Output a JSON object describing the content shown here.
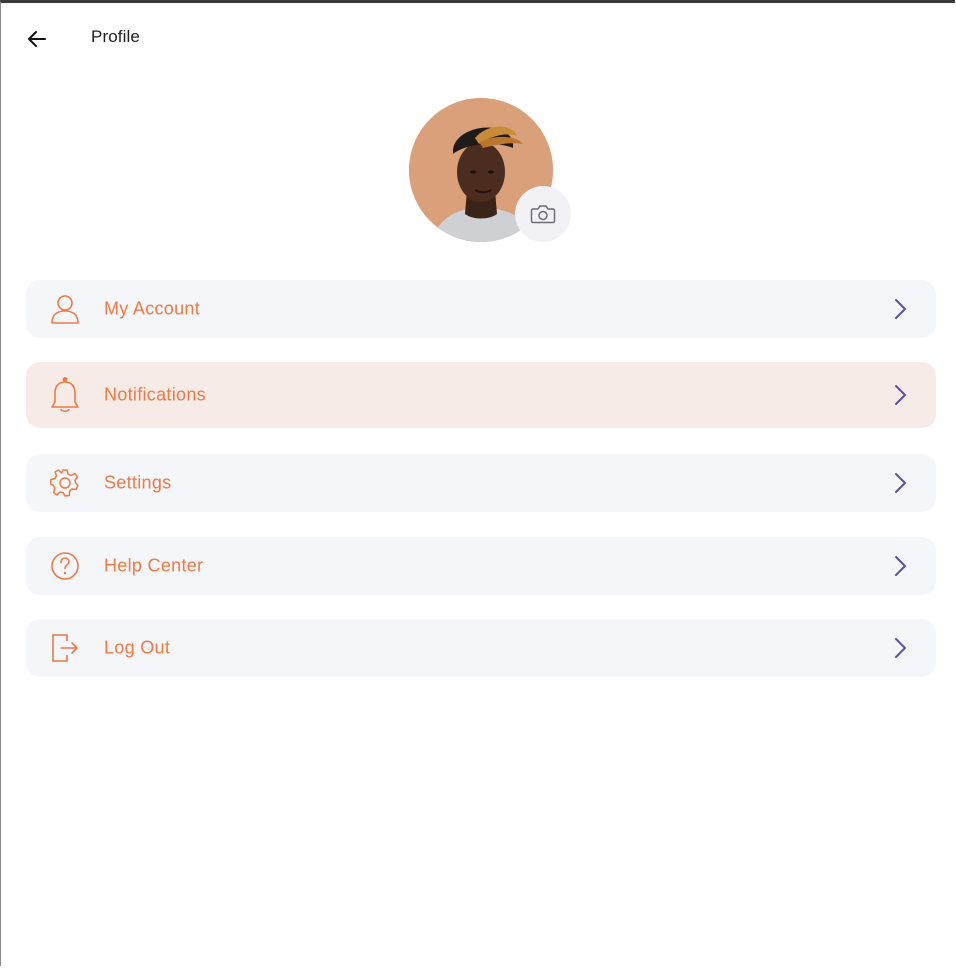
{
  "header": {
    "title": "Profile",
    "back_icon": "arrow-left-icon"
  },
  "profile": {
    "avatar": "user-photo",
    "camera_icon": "camera-icon"
  },
  "colors": {
    "accent": "#EE7A45",
    "chevron": "#5B4FA8",
    "item_bg": "#F5F6FA",
    "item_active_bg": "#F6EBE7"
  },
  "menu": {
    "items": [
      {
        "label": "My Account",
        "icon": "user-icon",
        "active": false
      },
      {
        "label": "Notifications",
        "icon": "bell-icon",
        "active": true
      },
      {
        "label": "Settings",
        "icon": "gear-icon",
        "active": false
      },
      {
        "label": "Help Center",
        "icon": "question-circle-icon",
        "active": false
      },
      {
        "label": "Log Out",
        "icon": "logout-icon",
        "active": false
      }
    ]
  }
}
